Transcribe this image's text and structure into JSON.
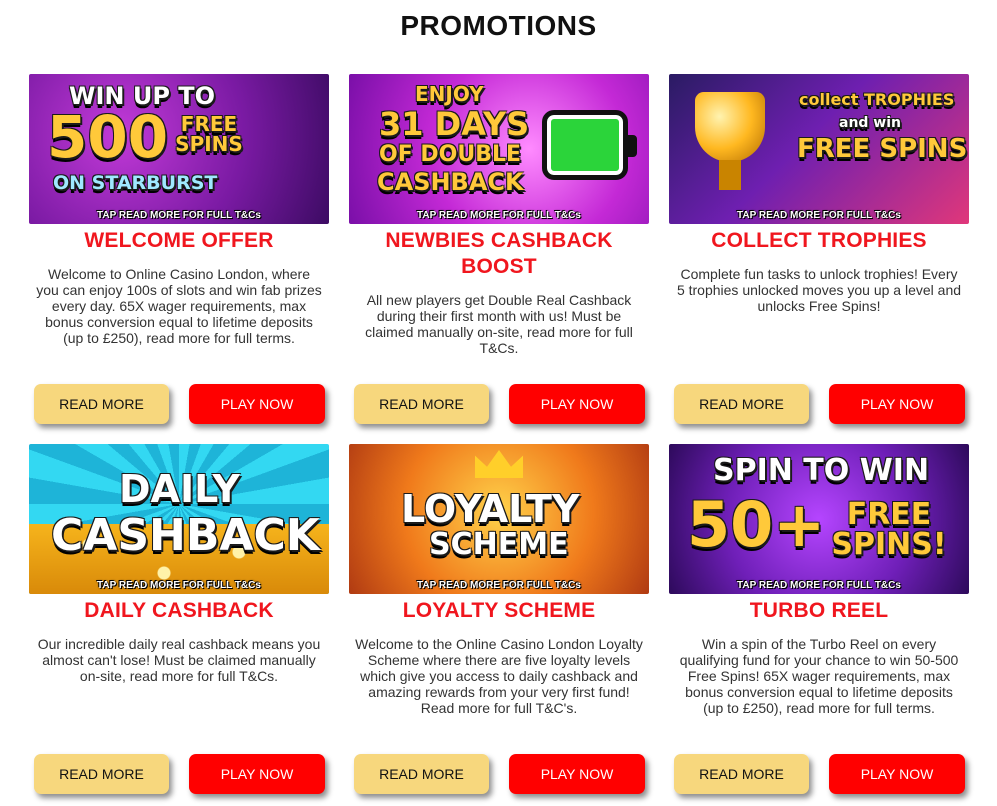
{
  "page": {
    "title": "PROMOTIONS"
  },
  "colors": {
    "title_red": "#f0161e",
    "read_button": "#f7d77d",
    "play_button": "#ff0000"
  },
  "buttons": {
    "read_more": "READ MORE",
    "play_now": "PLAY NOW"
  },
  "banner_strap": "TAP READ MORE FOR FULL T&Cs",
  "promotions": [
    {
      "title": "WELCOME OFFER",
      "banner_text": [
        "WIN UP TO",
        "500",
        "FREE SPINS",
        "ON STARBURST"
      ],
      "description": "Welcome to Online Casino London, where you can enjoy 100s of slots and win fab prizes every day. 65X wager requirements, max bonus conversion equal to lifetime deposits (up to £250), read more for full terms."
    },
    {
      "title": "NEWBIES CASHBACK BOOST",
      "banner_text": [
        "ENJOY",
        "31 DAYS",
        "OF DOUBLE",
        "CASHBACK"
      ],
      "description": "All new players get Double Real Cashback during their first month with us! Must be claimed manually on-site, read more for full T&Cs."
    },
    {
      "title": "COLLECT TROPHIES",
      "banner_text": [
        "collect TROPHIES",
        "and win",
        "FREE SPINS"
      ],
      "description": "Complete fun tasks to unlock trophies! Every 5 trophies unlocked moves you up a level and unlocks Free Spins!"
    },
    {
      "title": "DAILY CASHBACK",
      "banner_text": [
        "DAILY",
        "CASHBACK"
      ],
      "description": "Our incredible daily real cashback means you almost can't lose! Must be claimed manually on-site, read more for full T&Cs."
    },
    {
      "title": "LOYALTY SCHEME",
      "banner_text": [
        "LOYALTY",
        "SCHEME"
      ],
      "description": "Welcome to the Online Casino London Loyalty Scheme where there are five loyalty levels which give you access to daily cashback and amazing rewards from your very first fund! Read more for full T&C's."
    },
    {
      "title": "TURBO REEL",
      "banner_text": [
        "SPIN TO WIN",
        "50+",
        "FREE SPINS!"
      ],
      "description": "Win a spin of the Turbo Reel on every qualifying fund for your chance to win 50-500 Free Spins! 65X wager requirements, max bonus conversion equal to lifetime deposits (up to £250), read more for full terms."
    }
  ]
}
